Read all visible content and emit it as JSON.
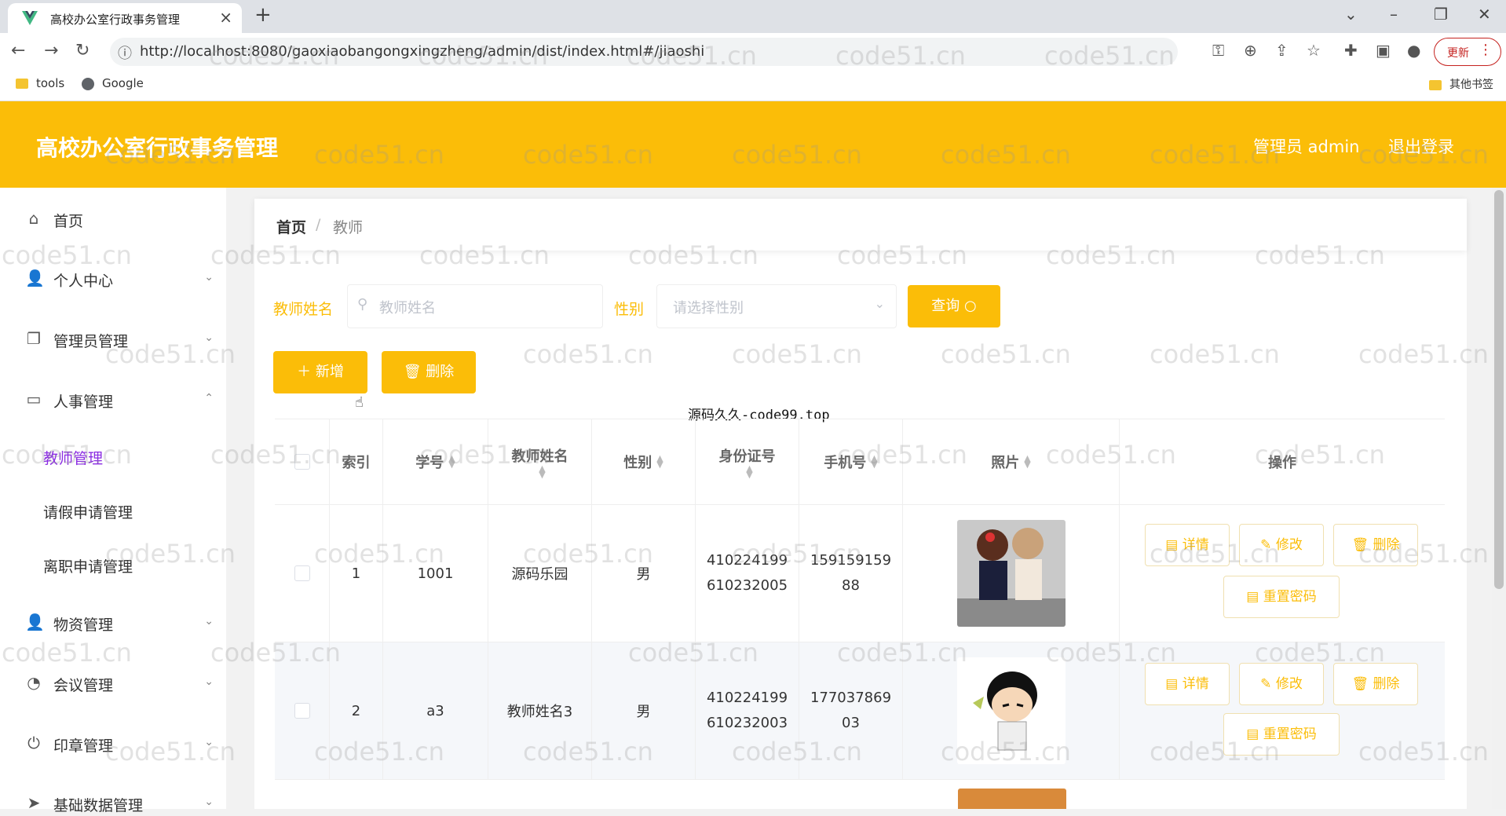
{
  "browser": {
    "tab_title": "高校办公室行政事务管理",
    "url": "http://localhost:8080/gaoxiaobangongxingzheng/admin/dist/index.html#/jiaoshi",
    "update_label": "更新",
    "bookmarks": [
      "tools",
      "Google"
    ],
    "other_bookmarks": "其他书签"
  },
  "header": {
    "title": "高校办公室行政事务管理",
    "user": "管理员 admin",
    "logout": "退出登录"
  },
  "sidebar": {
    "items": [
      {
        "label": "首页",
        "icon": "home-icon"
      },
      {
        "label": "个人中心",
        "icon": "user-icon"
      },
      {
        "label": "管理员管理",
        "icon": "copy-icon"
      },
      {
        "label": "人事管理",
        "icon": "chat-icon"
      },
      {
        "label": "物资管理",
        "icon": "user-icon"
      },
      {
        "label": "会议管理",
        "icon": "compass-icon"
      },
      {
        "label": "印章管理",
        "icon": "power-icon"
      },
      {
        "label": "基础数据管理",
        "icon": "send-icon"
      }
    ],
    "sub_items": [
      "教师管理",
      "请假申请管理",
      "离职申请管理"
    ]
  },
  "breadcrumb": {
    "home": "首页",
    "sep": "/",
    "current": "教师"
  },
  "search": {
    "name_label": "教师姓名",
    "name_placeholder": "教师姓名",
    "gender_label": "性别",
    "gender_placeholder": "请选择性别",
    "query_button": "查询"
  },
  "actions": {
    "add": "新增",
    "delete": "删除"
  },
  "center_watermark": "源码久久-code99.top",
  "table": {
    "headers": [
      "索引",
      "学号",
      "教师姓名",
      "性别",
      "身份证号",
      "手机号",
      "照片",
      "操作"
    ],
    "rows": [
      {
        "index": "1",
        "id": "1001",
        "name": "源码乐园",
        "gender": "男",
        "idcard_1": "410224199",
        "idcard_2": "610232005",
        "phone_1": "159159159",
        "phone_2": "88"
      },
      {
        "index": "2",
        "id": "a3",
        "name": "教师姓名3",
        "gender": "男",
        "idcard_1": "410224199",
        "idcard_2": "610232003",
        "phone_1": "177037869",
        "phone_2": "03"
      }
    ],
    "row_buttons": {
      "detail": "详情",
      "edit": "修改",
      "delete": "删除",
      "reset": "重置密码"
    }
  },
  "watermark": "code51.cn",
  "colors": {
    "accent": "#fbbd08",
    "active_sub": "#8a2be2"
  }
}
